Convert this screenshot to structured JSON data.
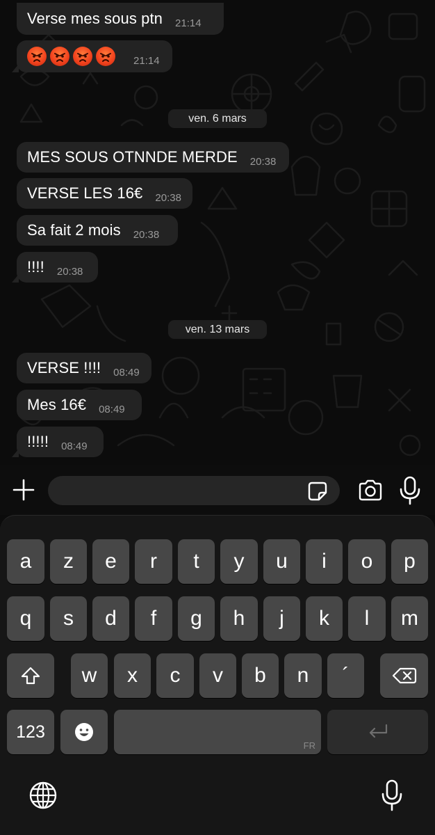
{
  "chat": {
    "messages": [
      {
        "text": "Verse mes sous ptn",
        "time": "21:14"
      },
      {
        "emoji": [
          "angry-face-emoji",
          "angry-face-emoji",
          "angry-face-emoji",
          "angry-face-emoji"
        ],
        "time": "21:14"
      },
      {
        "text": "MES SOUS OTNNDE MERDE",
        "time": "20:38"
      },
      {
        "text": "VERSE LES 16€",
        "time": "20:38"
      },
      {
        "text": "Sa fait 2 mois",
        "time": "20:38"
      },
      {
        "text": "!!!!",
        "time": "20:38"
      },
      {
        "text": "VERSE !!!!",
        "time": "08:49"
      },
      {
        "text": "Mes 16€",
        "time": "08:49"
      },
      {
        "text": "!!!!!",
        "time": "08:49"
      }
    ],
    "date_separators": [
      "ven. 6 mars",
      "ven. 13 mars"
    ]
  },
  "composer": {
    "input_value": "",
    "icons": [
      "plus-icon",
      "sticker-icon",
      "camera-icon",
      "microphone-icon"
    ]
  },
  "keyboard": {
    "row1": [
      "a",
      "z",
      "e",
      "r",
      "t",
      "y",
      "u",
      "i",
      "o",
      "p"
    ],
    "row2": [
      "q",
      "s",
      "d",
      "f",
      "g",
      "h",
      "j",
      "k",
      "l",
      "m"
    ],
    "row3": [
      "w",
      "x",
      "c",
      "v",
      "b",
      "n",
      "´"
    ],
    "numbers_key": "123",
    "space_language": "FR",
    "icons": [
      "shift-icon",
      "backspace-icon",
      "emoji-icon",
      "return-icon",
      "globe-icon",
      "dictation-icon"
    ]
  },
  "colors": {
    "background": "#0c0c0c",
    "bubble": "#232323",
    "key": "#474747",
    "key_dark": "#2c2c2c",
    "keyboard_bg": "#161616"
  }
}
